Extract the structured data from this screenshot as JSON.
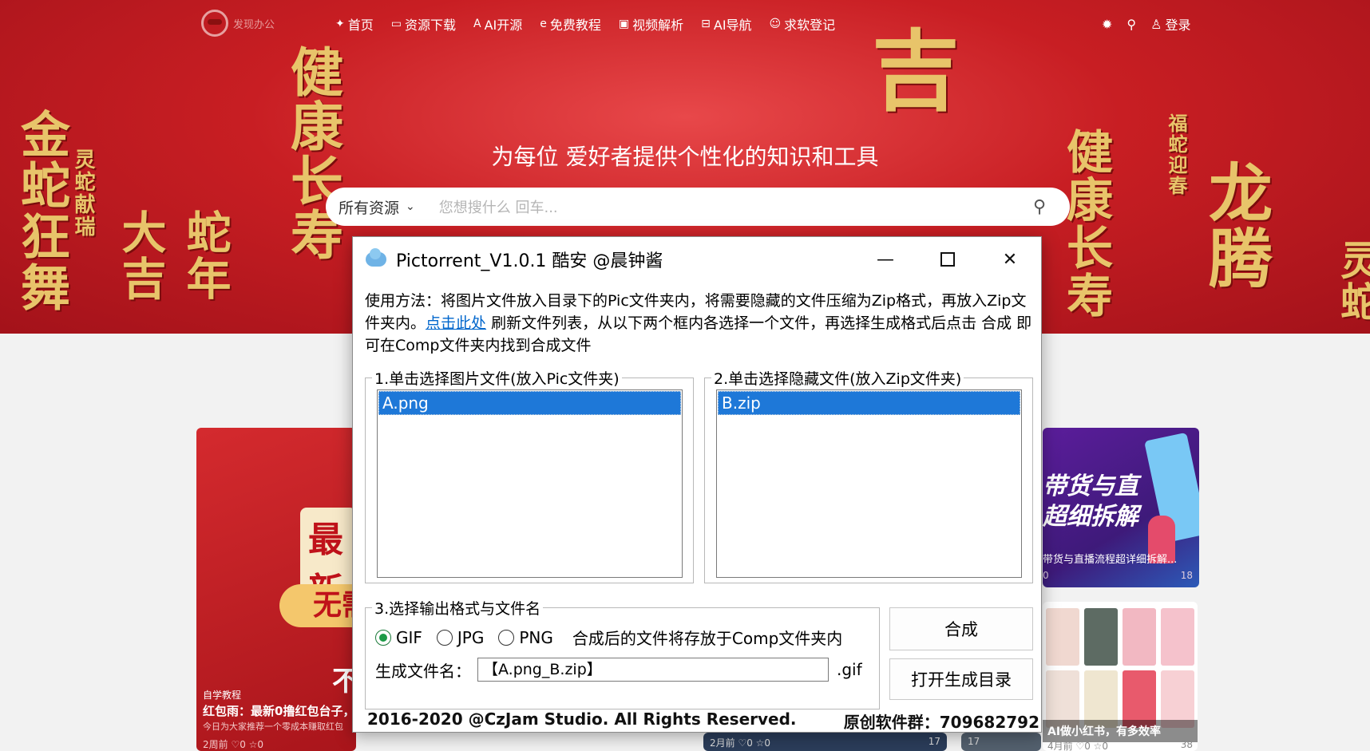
{
  "site": {
    "logo_text": "发现办公",
    "nav": [
      {
        "icon": "weibo",
        "label": "首页"
      },
      {
        "icon": "monitor",
        "label": "资源下载"
      },
      {
        "icon": "ai",
        "label": "AI开源"
      },
      {
        "icon": "edge",
        "label": "免费教程"
      },
      {
        "icon": "play",
        "label": "视频解析"
      },
      {
        "icon": "nav",
        "label": "AI导航"
      },
      {
        "icon": "smile",
        "label": "求软登记"
      }
    ],
    "right": {
      "login_label": "登录"
    },
    "hero_title": "为每位 爱好者提供个性化的知识和工具",
    "search": {
      "category": "所有资源",
      "placeholder": "您想搜什么  回车..."
    },
    "decor": {
      "ji": "吉",
      "left1": "金蛇狂舞",
      "left2": "灵蛇献瑞",
      "left3": "蛇年大吉",
      "center": "健康长寿",
      "right1": "健康长寿",
      "right2": "福蛇迎春",
      "right3": "龙腾",
      "right4": "灵蛇"
    },
    "cards": {
      "left": {
        "big": "最新",
        "pill": "无需",
        "bu": "不",
        "tag": "自学教程",
        "title": "红包雨：最新0撸红包台子，",
        "subtitle": "今日为大家推荐一个零成本赚取红包",
        "stats": "2周前  ♡0  ☆0"
      },
      "right_top": {
        "line1": "带货与直",
        "line2": "超细拆解",
        "caption": "带货与直播流程超详细拆解...",
        "likes": "0",
        "views": "18"
      },
      "right_bottom": {
        "caption": "AI做小红书，有多效率",
        "stats": "4月前  ♡0  ☆0",
        "views": "38"
      },
      "mid1": {
        "stats": "2月前  ♡0  ☆0",
        "views": "17"
      },
      "mid2": {
        "views": "17"
      }
    }
  },
  "app": {
    "title": "Pictorrent_V1.0.1   酷安 @晨钟酱",
    "usage_part1": "使用方法：将图片文件放入目录下的Pic文件夹内，将需要隐藏的文件压缩为Zip格式，再放入Zip文件夹内。",
    "usage_link": "点击此处",
    "usage_part2": " 刷新文件列表，从以下两个框内各选择一个文件，再选择生成格式后点击 合成 即可在Comp文件夹内找到合成文件",
    "group1_label": "1.单击选择图片文件(放入Pic文件夹)",
    "group1_items": [
      "A.png"
    ],
    "group2_label": "2.单击选择隐藏文件(放入Zip文件夹)",
    "group2_items": [
      "B.zip"
    ],
    "group3_label": "3.选择输出格式与文件名",
    "formats": [
      "GIF",
      "JPG",
      "PNG"
    ],
    "selected_format": "GIF",
    "format_note": "合成后的文件将存放于Comp文件夹内",
    "filename_label": "生成文件名：",
    "filename_value": "【A.png_B.zip】",
    "filename_ext": ".gif",
    "btn_make": "合成",
    "btn_open": "打开生成目录",
    "copyright": "2016-2020 @CzJam Studio. All Rights Reserved.",
    "group_info": "原创软件群：709682792"
  },
  "colors": {
    "selection": "#1e78d8",
    "hero": "#c81e23",
    "radio_on": "#1c9a46",
    "link": "#0066cc"
  }
}
